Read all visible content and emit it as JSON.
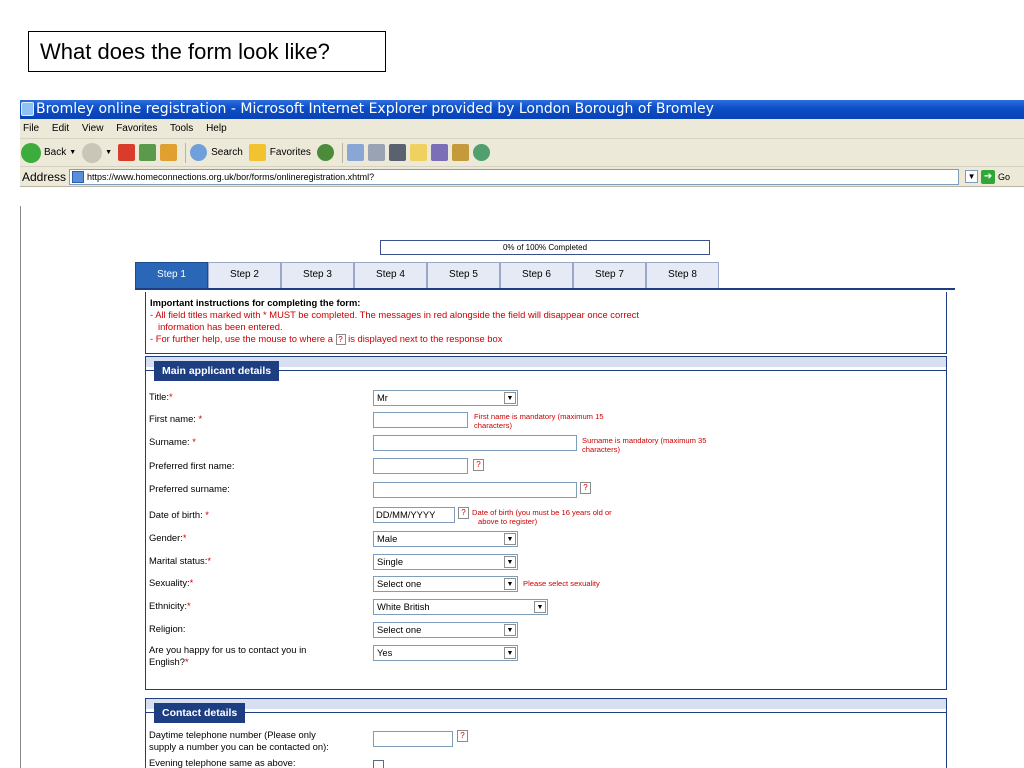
{
  "slide": {
    "title": "What does the form look like?"
  },
  "window": {
    "title": "Bromley online registration - Microsoft Internet Explorer provided by London Borough of Bromley"
  },
  "menu": {
    "items": [
      "File",
      "Edit",
      "View",
      "Favorites",
      "Tools",
      "Help"
    ]
  },
  "toolbar": {
    "back_label": "Back",
    "search_label": "Search",
    "favorites_label": "Favorites"
  },
  "address": {
    "label": "Address",
    "url": "https://www.homeconnections.org.uk/bor/forms/onlineregistration.xhtml?",
    "go_label": "Go"
  },
  "progress": {
    "text": "0% of 100% Completed",
    "value_percent": 0
  },
  "tabs": [
    "Step 1",
    "Step 2",
    "Step 3",
    "Step 4",
    "Step 5",
    "Step 6",
    "Step 7",
    "Step 8"
  ],
  "instructions": {
    "heading": "Important instructions for completing the form:",
    "line1": "- All field titles marked with * MUST be completed. The messages in red alongside the field will disappear once correct",
    "line2": "information has been entered.",
    "line3a": "- For further help, use the mouse to where a",
    "line3b": "is displayed next to the response box",
    "help_mark": "?"
  },
  "main_section": {
    "legend": "Main applicant details",
    "fields": {
      "title": {
        "label": "Title:",
        "value": "Mr"
      },
      "first_name": {
        "label": "First name:",
        "error1": "First name is mandatory (maximum 15",
        "error2": "characters)"
      },
      "surname": {
        "label": "Surname:",
        "error1": "Surname is mandatory (maximum 35",
        "error2": "characters)"
      },
      "preferred_first": {
        "label": "Preferred first name:"
      },
      "preferred_surname": {
        "label": "Preferred surname:"
      },
      "dob": {
        "label": "Date of birth:",
        "value": "DD/MM/YYYY",
        "error1": "Date of birth (you must be 16 years old or",
        "error2": "above to register)"
      },
      "gender": {
        "label": "Gender:",
        "value": "Male"
      },
      "marital": {
        "label": "Marital status:",
        "value": "Single"
      },
      "sexuality": {
        "label": "Sexuality:",
        "value": "Select one",
        "error": "Please select sexuality"
      },
      "ethnicity": {
        "label": "Ethnicity:",
        "value": "White British"
      },
      "religion": {
        "label": "Religion:",
        "value": "Select one"
      },
      "english": {
        "label1": "Are you happy for us to contact you in",
        "label2": "English?",
        "value": "Yes"
      }
    },
    "required_mark": "*",
    "help_mark": "?"
  },
  "contact_section": {
    "legend": "Contact details",
    "daytime_label1": "Daytime telephone number (Please only",
    "daytime_label2": "supply a number you can be contacted on):",
    "evening_label": "Evening telephone same as above:",
    "help_mark": "?"
  },
  "colors": {
    "titlebar": "#0c4fc8",
    "accent_navy": "#1d3e80",
    "tab_active": "#2a67b7",
    "error_red": "#cc0000"
  }
}
